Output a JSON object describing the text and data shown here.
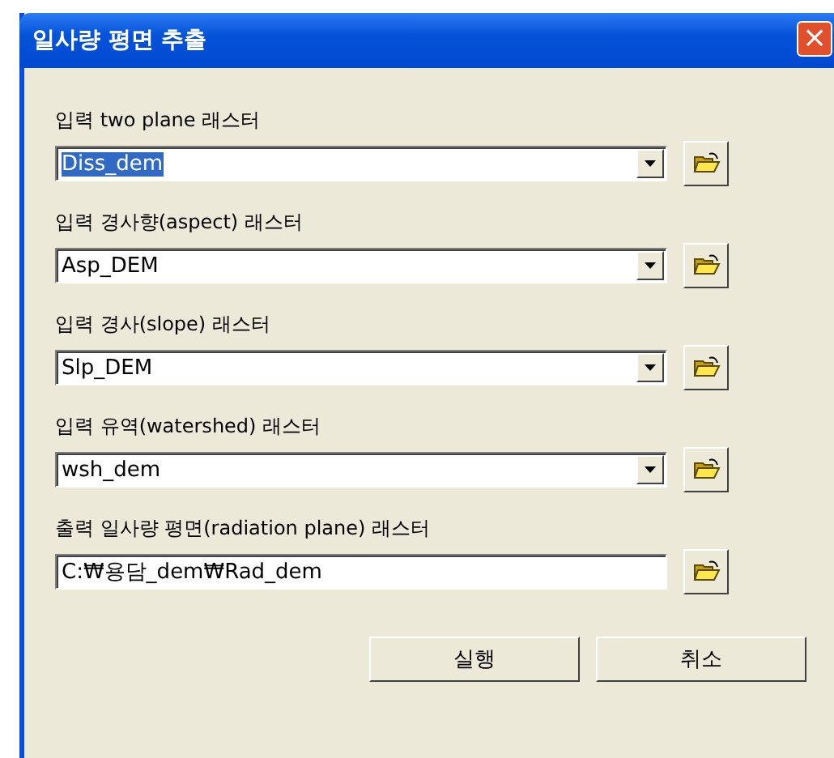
{
  "window": {
    "title": "일사량 평면 추출",
    "close": "×"
  },
  "fields": [
    {
      "kind": "combo",
      "label": "입력 two plane 래스터",
      "value": "Diss_dem",
      "selected": true
    },
    {
      "kind": "combo",
      "label": "입력 경사향(aspect) 래스터",
      "value": "Asp_DEM",
      "selected": false
    },
    {
      "kind": "combo",
      "label": "입력 경사(slope) 래스터",
      "value": "Slp_DEM",
      "selected": false
    },
    {
      "kind": "combo",
      "label": "입력 유역(watershed) 래스터",
      "value": "wsh_dem",
      "selected": false
    },
    {
      "kind": "text",
      "label": "출력 일사량 평면(radiation plane) 래스터",
      "value": "C:₩용담_dem₩Rad_dem",
      "selected": false
    }
  ],
  "buttons": [
    "실행",
    "취소"
  ]
}
